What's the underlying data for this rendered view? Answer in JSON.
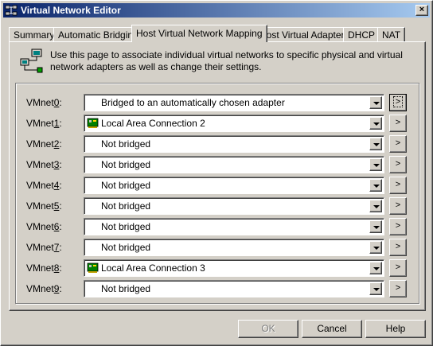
{
  "window": {
    "title": "Virtual Network Editor",
    "close_glyph": "×"
  },
  "tabs": [
    {
      "label": "Summary",
      "active": false
    },
    {
      "label": "Automatic Bridging",
      "active": false
    },
    {
      "label": "Host Virtual Network Mapping",
      "active": true
    },
    {
      "label": "Host Virtual Adapters",
      "active": false
    },
    {
      "label": "DHCP",
      "active": false
    },
    {
      "label": "NAT",
      "active": false
    }
  ],
  "info": {
    "icon": "network-mapping-icon",
    "text": "Use this page to associate individual virtual networks to specific physical and virtual network adapters as well as change their settings."
  },
  "mappings": [
    {
      "name": "VMnet",
      "num": "0",
      "value": "Bridged to an automatically chosen adapter",
      "adapter_icon": false
    },
    {
      "name": "VMnet",
      "num": "1",
      "value": "Local Area Connection 2",
      "adapter_icon": true
    },
    {
      "name": "VMnet",
      "num": "2",
      "value": "Not bridged",
      "adapter_icon": false
    },
    {
      "name": "VMnet",
      "num": "3",
      "value": "Not bridged",
      "adapter_icon": false
    },
    {
      "name": "VMnet",
      "num": "4",
      "value": "Not bridged",
      "adapter_icon": false
    },
    {
      "name": "VMnet",
      "num": "5",
      "value": "Not bridged",
      "adapter_icon": false
    },
    {
      "name": "VMnet",
      "num": "6",
      "value": "Not bridged",
      "adapter_icon": false
    },
    {
      "name": "VMnet",
      "num": "7",
      "value": "Not bridged",
      "adapter_icon": false
    },
    {
      "name": "VMnet",
      "num": "8",
      "value": "Local Area Connection 3",
      "adapter_icon": true
    },
    {
      "name": "VMnet",
      "num": "9",
      "value": "Not bridged",
      "adapter_icon": false
    }
  ],
  "more_button_label": ">",
  "buttons": {
    "ok": "OK",
    "cancel": "Cancel",
    "help": "Help"
  }
}
